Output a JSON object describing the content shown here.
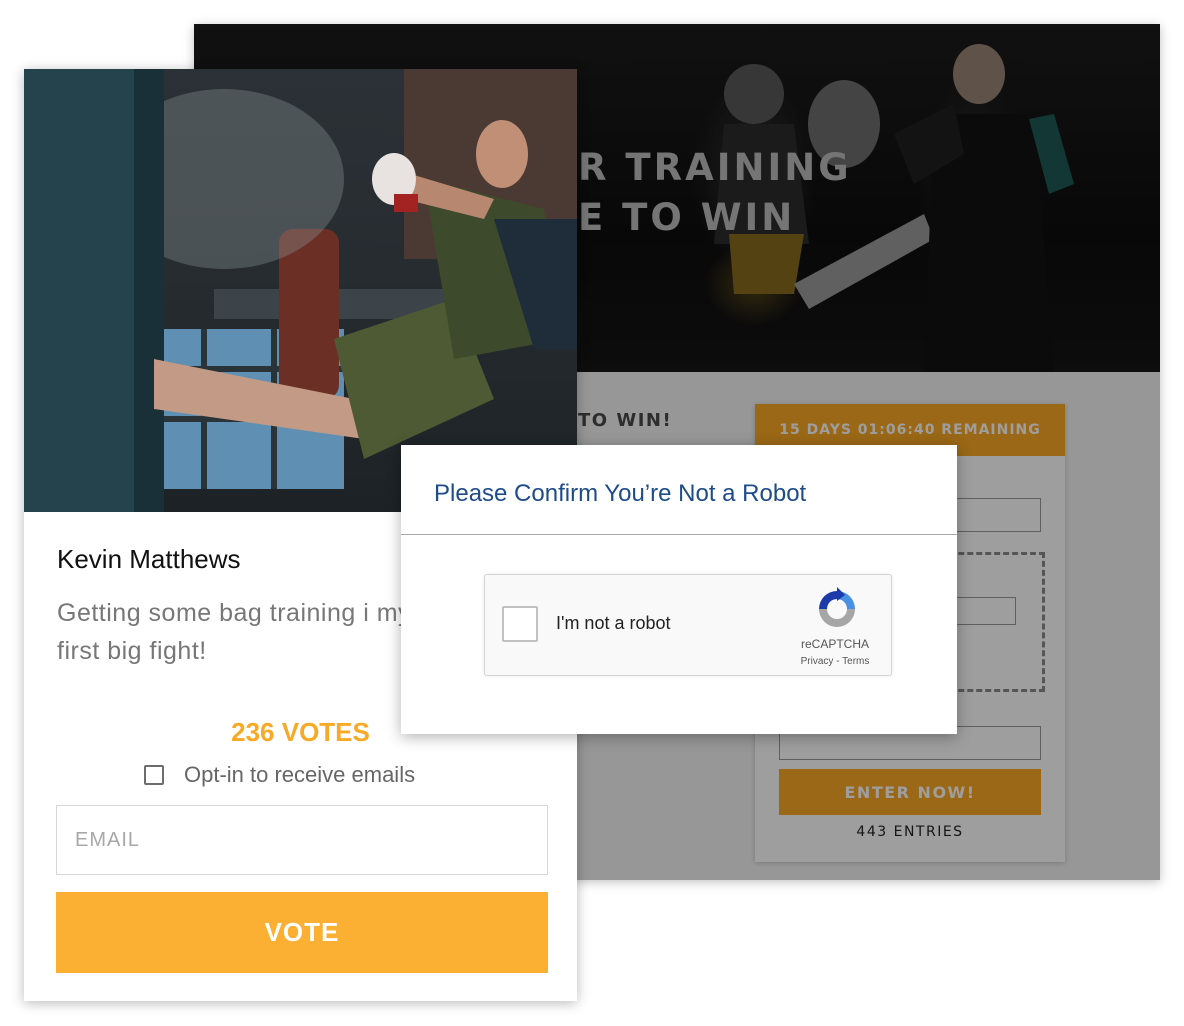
{
  "background_page": {
    "hero_line_1": "R TRAINING",
    "hero_line_2": "E TO WIN",
    "subheading": "TO WIN!",
    "timer_text": "15 DAYS 01:06:40 REMAINING",
    "enter_button": "ENTER NOW!",
    "entries_count": "443 ENTRIES"
  },
  "entry_card": {
    "name": "Kevin Matthews",
    "description": "Getting some bag training i my first big fight!",
    "votes_label": "236 VOTES",
    "optin_label": "Opt-in to receive emails",
    "email_placeholder": "EMAIL",
    "vote_button": "VOTE"
  },
  "robot_modal": {
    "title": "Please Confirm You’re Not a Robot",
    "checkbox_label": "I'm not a robot",
    "brand": "reCAPTCHA",
    "links": "Privacy - Terms"
  },
  "colors": {
    "accent_orange": "#fbb034",
    "modal_title_blue": "#1e4b8a"
  }
}
